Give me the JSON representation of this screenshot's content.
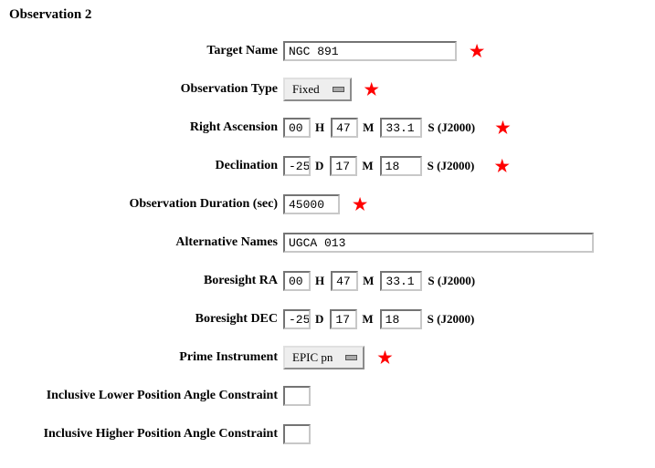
{
  "heading": "Observation 2",
  "labels": {
    "target_name": "Target Name",
    "obs_type": "Observation Type",
    "ra": "Right Ascension",
    "dec": "Declination",
    "duration": "Observation Duration (sec)",
    "alt_names": "Alternative Names",
    "bore_ra": "Boresight RA",
    "bore_dec": "Boresight DEC",
    "prime_instr": "Prime Instrument",
    "ilpac": "Inclusive Lower Position Angle Constraint",
    "ihpac": "Inclusive Higher Position Angle Constraint"
  },
  "fields": {
    "target_name": "NGC 891",
    "obs_type": "Fixed",
    "ra": {
      "h": "00",
      "m": "47",
      "s": "33.1"
    },
    "dec": {
      "d": "-25",
      "m": "17",
      "s": "18"
    },
    "duration": "45000",
    "alt_names": "UGCA 013",
    "bore_ra": {
      "h": "00",
      "m": "47",
      "s": "33.1"
    },
    "bore_dec": {
      "d": "-25",
      "m": "17",
      "s": "18"
    },
    "prime_instr": "EPIC pn",
    "ilpac": "",
    "ihpac": ""
  },
  "units": {
    "H": "H",
    "M": "M",
    "S": "S",
    "D": "D",
    "j2000": "S (J2000)"
  },
  "star": "★"
}
